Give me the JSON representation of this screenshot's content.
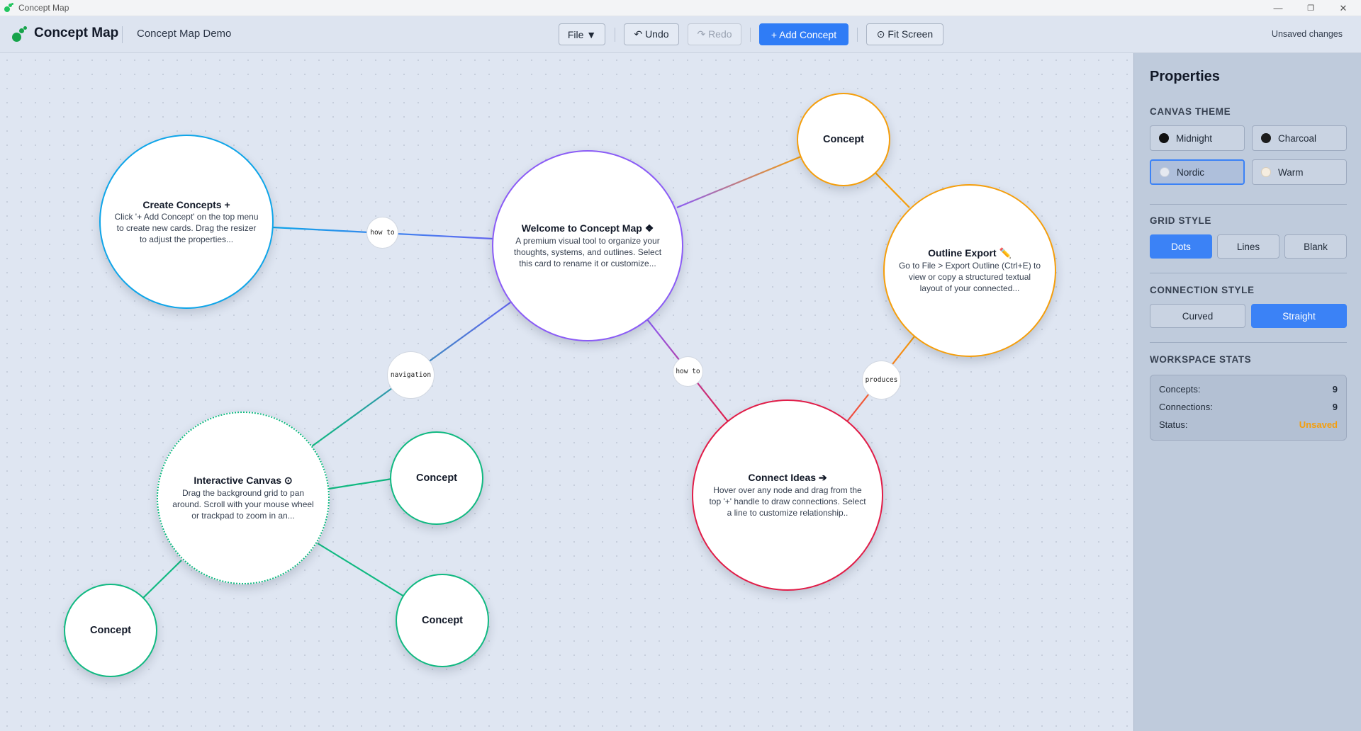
{
  "window": {
    "title": "Concept Map",
    "minimize": "—",
    "maximize": "❐",
    "close": "✕"
  },
  "toolbar": {
    "brand": "Concept Map",
    "doc_title": "Concept Map Demo",
    "file_label": "File ▼",
    "undo_label": "↶ Undo",
    "redo_label": "↷ Redo",
    "add_label": "+ Add Concept",
    "fit_label": "⊙ Fit Screen",
    "status": "Unsaved changes"
  },
  "nodes": [
    {
      "title": "Welcome to Concept Map ❖",
      "desc": "A premium visual tool to organize your thoughts, systems, and outlines. Select this card to rename it or customize...",
      "color": "#8b5cf6"
    },
    {
      "title": "Create Concepts +",
      "desc": "Click '+ Add Concept' on the top menu to create new cards. Drag the resizer to adjust the properties...",
      "color": "#0ea5e9"
    },
    {
      "title": "Outline Export ✏️",
      "desc": "Go to File > Export Outline (Ctrl+E) to view or copy a structured textual layout of your connected...",
      "color": "#f59e0b"
    },
    {
      "title": "Interactive Canvas ⊙",
      "desc": "Drag the background grid to pan around. Scroll with your mouse wheel or trackpad to zoom in an...",
      "color": "#10b981"
    },
    {
      "title": "Connect Ideas ➔",
      "desc": "Hover over any node and drag from the top '+' handle to draw connections. Select a line to customize relationship..",
      "color": "#e11d48"
    },
    {
      "title": "Concept",
      "desc": "",
      "color": "#f59e0b"
    },
    {
      "title": "Concept",
      "desc": "",
      "color": "#10b981"
    },
    {
      "title": "Concept",
      "desc": "",
      "color": "#10b981"
    },
    {
      "title": "Concept",
      "desc": "",
      "color": "#10b981"
    }
  ],
  "edge_labels": [
    "how to",
    "navigation",
    "how to",
    "produces"
  ],
  "panel": {
    "title": "Properties",
    "canvas_theme": {
      "heading": "CANVAS THEME",
      "options": [
        {
          "label": "Midnight",
          "swatch": "#111111"
        },
        {
          "label": "Charcoal",
          "swatch": "#1c1c1c"
        },
        {
          "label": "Nordic",
          "swatch": "#e5e9f0"
        },
        {
          "label": "Warm",
          "swatch": "#f5ede0"
        }
      ],
      "selected": "Nordic"
    },
    "grid_style": {
      "heading": "GRID STYLE",
      "options": [
        "Dots",
        "Lines",
        "Blank"
      ],
      "selected": "Dots"
    },
    "connection_style": {
      "heading": "CONNECTION STYLE",
      "options": [
        "Curved",
        "Straight"
      ],
      "selected": "Straight"
    },
    "stats": {
      "heading": "WORKSPACE STATS",
      "concepts_label": "Concepts:",
      "concepts_value": "9",
      "connections_label": "Connections:",
      "connections_value": "9",
      "status_label": "Status:",
      "status_value": "Unsaved"
    }
  },
  "colors": {
    "accent": "#3b82f6",
    "brand": "#16a34a",
    "unsaved": "#f59e0b"
  }
}
